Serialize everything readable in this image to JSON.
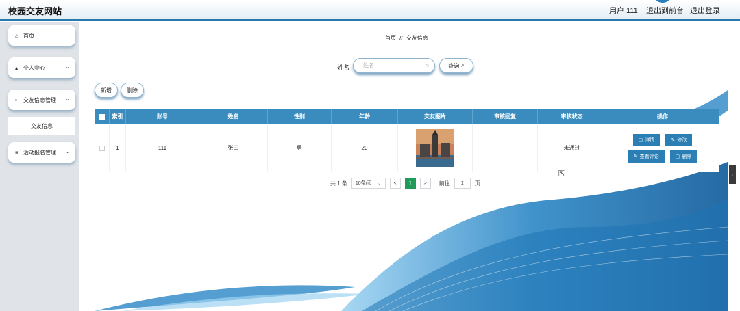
{
  "header": {
    "site_title": "校园交友网站",
    "user_label": "用户 111",
    "back_to_front": "退出到前台",
    "logout": "退出登录"
  },
  "sidebar": {
    "items": [
      {
        "icon": "home-icon",
        "glyph": "⌂",
        "label": "首页"
      },
      {
        "icon": "person-icon",
        "glyph": "▴",
        "label": "个人中心",
        "chevron": "⌄"
      },
      {
        "icon": "grid-icon",
        "glyph": "▪",
        "label": "交友信息管理",
        "chevron": "⌄"
      },
      {
        "icon": "list-icon",
        "glyph": "≡",
        "label": "活动报名管理",
        "chevron": "⌄"
      }
    ],
    "sub_item": "交友信息"
  },
  "breadcrumb": {
    "home": "首页",
    "sep": "//",
    "current": "交友信息"
  },
  "search": {
    "label": "姓名",
    "placeholder": "姓名",
    "query_button": "查询",
    "query_icon": "search-icon"
  },
  "actions": {
    "add": "新增",
    "delete": "删除"
  },
  "table": {
    "columns": [
      "索引",
      "账号",
      "姓名",
      "性别",
      "年龄",
      "交友图片",
      "审核回复",
      "审核状态",
      "操作"
    ],
    "rows": [
      {
        "index": "1",
        "account": "111",
        "name": "张三",
        "gender": "男",
        "age": "20",
        "photo": "city-tower-photo",
        "reply": "",
        "status": "未通过",
        "ops": {
          "detail": "详情",
          "edit": "修改",
          "reviews": "查看评论",
          "delete": "删除"
        }
      }
    ]
  },
  "pager": {
    "total": "共 1 条",
    "page_size": "10条/页",
    "prev": "<",
    "current": "1",
    "next": ">",
    "goto": "前往",
    "goto_value": "1",
    "page_unit": "页"
  },
  "colors": {
    "accent": "#2a79ad",
    "header_blue": "#3a8cbf",
    "pager_active": "#1f9a5a",
    "sidebar_bg": "#e0e4e8"
  }
}
